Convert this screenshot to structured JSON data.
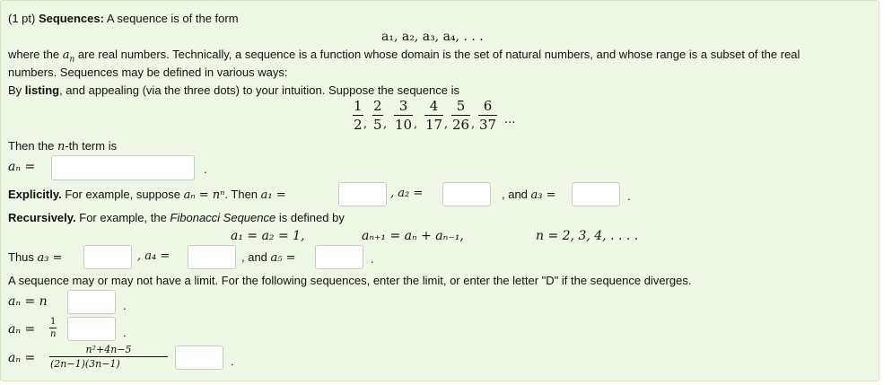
{
  "intro": {
    "points": "(1 pt)",
    "title": "Sequences:",
    "text": " A sequence is of the form",
    "form": "a₁, a₂, a₃, a₄, . . .",
    "where_1": "where the",
    "where_var": "a",
    "where_sub": "n",
    "where_2": " are real numbers. Technically, a sequence is a function whose domain is the set of natural numbers, and whose range is a subset of the real",
    "where_3": "numbers. Sequences may be defined in various ways:",
    "listing_bold": "listing",
    "listing_pre": "By ",
    "listing_post": ", and appealing (via the three dots) to your intuition. Suppose the sequence is"
  },
  "listing_seq": {
    "fractions": [
      {
        "num": "1",
        "den": "2"
      },
      {
        "num": "2",
        "den": "5"
      },
      {
        "num": "3",
        "den": "10"
      },
      {
        "num": "4",
        "den": "17"
      },
      {
        "num": "5",
        "den": "26"
      },
      {
        "num": "6",
        "den": "37"
      }
    ],
    "ellipsis": "..."
  },
  "nth": {
    "pre": "Then the ",
    "var": "n",
    "post": "-th term is",
    "lhs": "aₙ =",
    "period": "."
  },
  "explicit": {
    "bold": "Explicitly.",
    "pre": " For example, suppose ",
    "formula": "aₙ = nⁿ",
    "mid": ". Then ",
    "a1": "a₁ =",
    "a2": ", a₂ =",
    "and": ", and ",
    "a3": "a₃ =",
    "period": "."
  },
  "recursive": {
    "bold": "Recursively.",
    "pre": " For example, the ",
    "fib": "Fibonacci Sequence",
    "post": " is defined by",
    "eq1": "a₁ = a₂ = 1,",
    "eq2": "aₙ₊₁ = aₙ + aₙ₋₁,",
    "eq3": "n = 2, 3, 4, . . . .",
    "thus": "Thus ",
    "a3": "a₃ =",
    "a4": ", a₄ =",
    "and": ", and ",
    "a5": "a₅ =",
    "period": "."
  },
  "limits": {
    "text": "A sequence may or may not have a limit. For the following sequences, enter the limit, or enter the letter \"D\" if the sequence diverges.",
    "l1": "aₙ = n",
    "l2_lhs": "aₙ =",
    "l2_num": "1",
    "l2_den": "n",
    "l3_lhs": "aₙ =",
    "l3_num": "n²+4n−5",
    "l3_den": "(2n−1)(3n−1)",
    "period": "."
  }
}
